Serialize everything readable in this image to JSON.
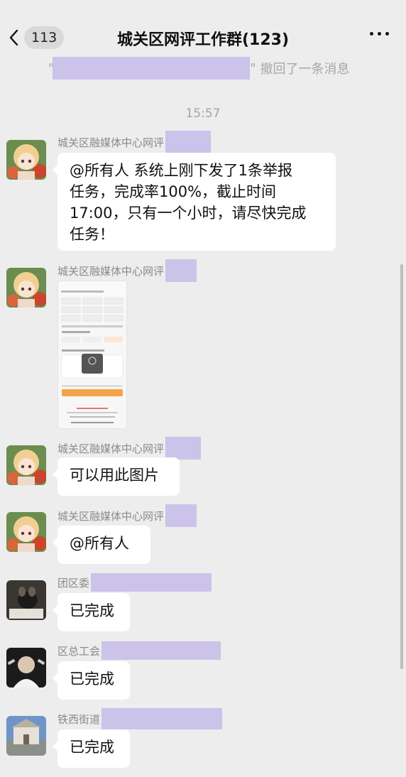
{
  "header": {
    "unread_count": "113",
    "title": "城关区网评工作群(123)"
  },
  "recall_notice": {
    "quote_open": "\"",
    "quote_close": "\"",
    "text": "撤回了一条消息"
  },
  "timestamp": "15:57",
  "messages": [
    {
      "sender": "城关区融媒体中心网评",
      "lines": [
        "@所有人  系统上刚下发了1条举报",
        "任务，完成率100%，截止时间",
        "17:00，只有一个小时，请尽快完成",
        "任务！"
      ]
    },
    {
      "sender": "城关区融媒体中心网评",
      "type": "image"
    },
    {
      "sender": "城关区融媒体中心网评",
      "text": "可以用此图片"
    },
    {
      "sender": "城关区融媒体中心网评",
      "text": "@所有人"
    },
    {
      "sender": "团区委",
      "text": "已完成"
    },
    {
      "sender": "区总工会",
      "text": "已完成"
    },
    {
      "sender": "铁西街道",
      "text": "已完成"
    }
  ],
  "colors": {
    "background": "#ededed",
    "bubble": "#ffffff",
    "redaction": "#cbc3e9"
  },
  "icons": [
    "back-chevron-icon",
    "more-dots-icon"
  ]
}
